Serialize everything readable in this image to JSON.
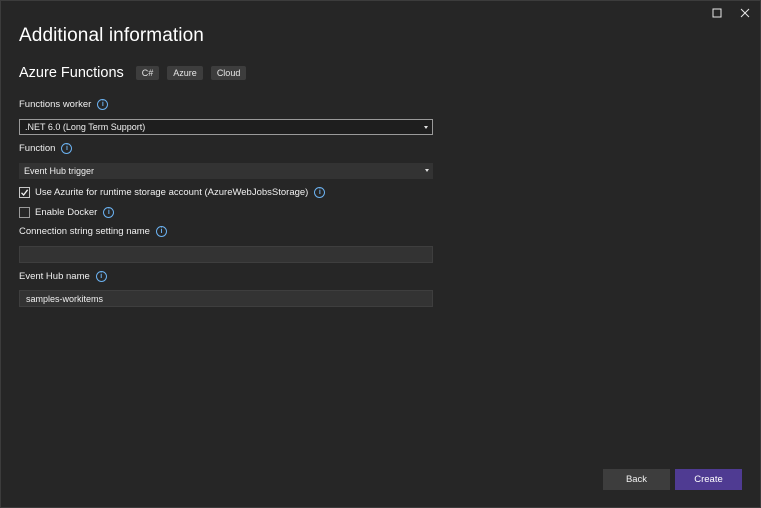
{
  "window": {
    "maximize_icon": "maximize-icon",
    "close_icon": "close-icon"
  },
  "header": {
    "title": "Additional information",
    "subtitle": "Azure Functions",
    "tags": [
      "C#",
      "Azure",
      "Cloud"
    ]
  },
  "form": {
    "functions_worker": {
      "label": "Functions worker",
      "value": ".NET 6.0 (Long Term Support)"
    },
    "function": {
      "label": "Function",
      "value": "Event Hub trigger"
    },
    "use_azurite": {
      "label": "Use Azurite for runtime storage account (AzureWebJobsStorage)",
      "checked": true
    },
    "enable_docker": {
      "label": "Enable Docker",
      "checked": false
    },
    "connection_string": {
      "label": "Connection string setting name",
      "value": ""
    },
    "event_hub_name": {
      "label": "Event Hub name",
      "value": "samples-workitems"
    }
  },
  "footer": {
    "back_label": "Back",
    "create_label": "Create"
  },
  "colors": {
    "accent": "#4f3b92",
    "info": "#6bb1f0",
    "background": "#262626"
  }
}
